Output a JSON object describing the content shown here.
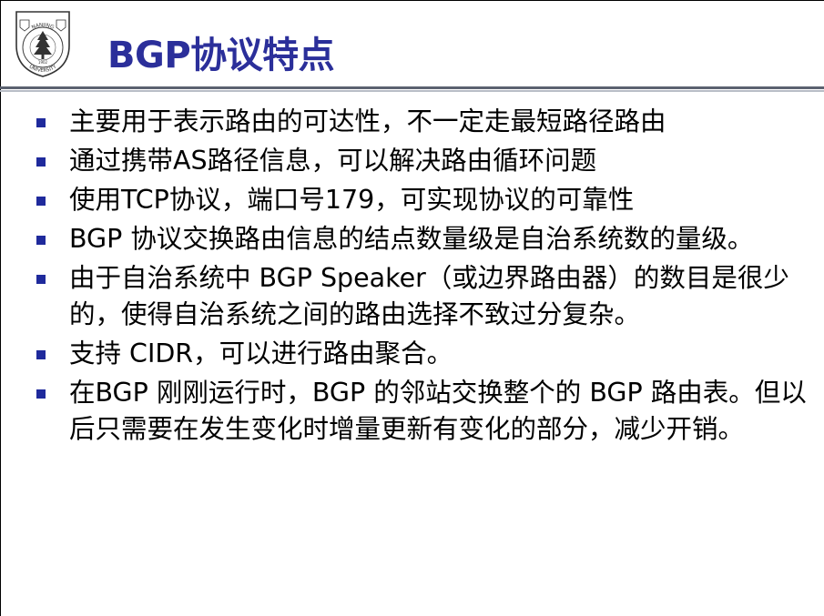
{
  "slide": {
    "title": "BGP协议特点",
    "logo": {
      "icon": "nanjing-university-emblem-icon",
      "text_top": "NANJING",
      "text_bottom": "UNIVERSITY",
      "year": "1902"
    },
    "colors": {
      "title": "#2b2f9a",
      "bullet": "#1f2a9c",
      "rule_dark": "#5b6270",
      "rule_light": "#b8bdc6"
    },
    "bullets": [
      "主要用于表示路由的可达性，不一定走最短路径路由",
      "通过携带AS路径信息，可以解决路由循环问题",
      "使用TCP协议，端口号179，可实现协议的可靠性",
      "BGP 协议交换路由信息的结点数量级是自治系统数的量级。",
      "由于自治系统中 BGP Speaker（或边界路由器）的数目是很少的，使得自治系统之间的路由选择不致过分复杂。",
      "支持 CIDR，可以进行路由聚合。",
      "在BGP 刚刚运行时，BGP 的邻站交换整个的 BGP 路由表。但以后只需要在发生变化时增量更新有变化的部分，减少开销。"
    ]
  }
}
